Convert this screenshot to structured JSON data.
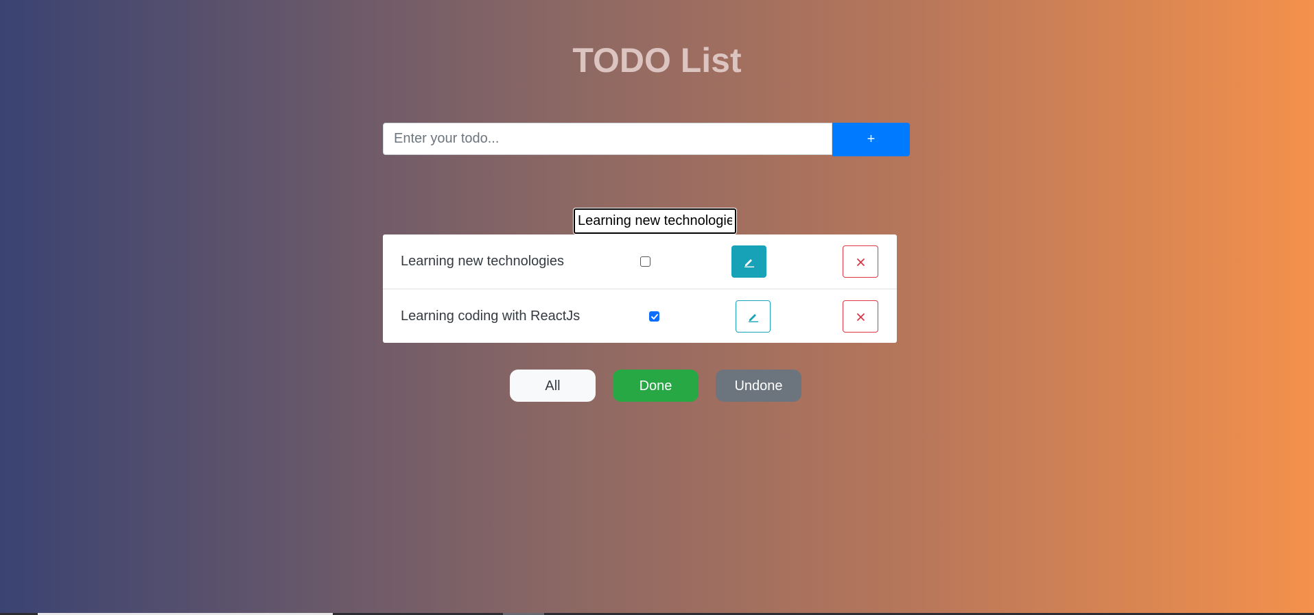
{
  "page": {
    "title": "TODO List"
  },
  "add_form": {
    "placeholder": "Enter your todo...",
    "value": "",
    "add_label": "+"
  },
  "edit_field": {
    "value": "Learning new technologie"
  },
  "todos": [
    {
      "label": "Learning new technologies",
      "done": false,
      "edit_icon": "pencil-icon",
      "delete_icon": "close-icon"
    },
    {
      "label": "Learning coding with ReactJs",
      "done": true,
      "edit_icon": "pencil-icon",
      "delete_icon": "close-icon"
    }
  ],
  "filters": {
    "all": "All",
    "done": "Done",
    "undone": "Undone"
  },
  "colors": {
    "gradient_start": "#3a4372",
    "gradient_end": "#f4914c",
    "add_button": "#007bff",
    "edit": "#17a2b8",
    "delete": "#dc3545",
    "done": "#28a745",
    "undone": "#6c757d"
  }
}
